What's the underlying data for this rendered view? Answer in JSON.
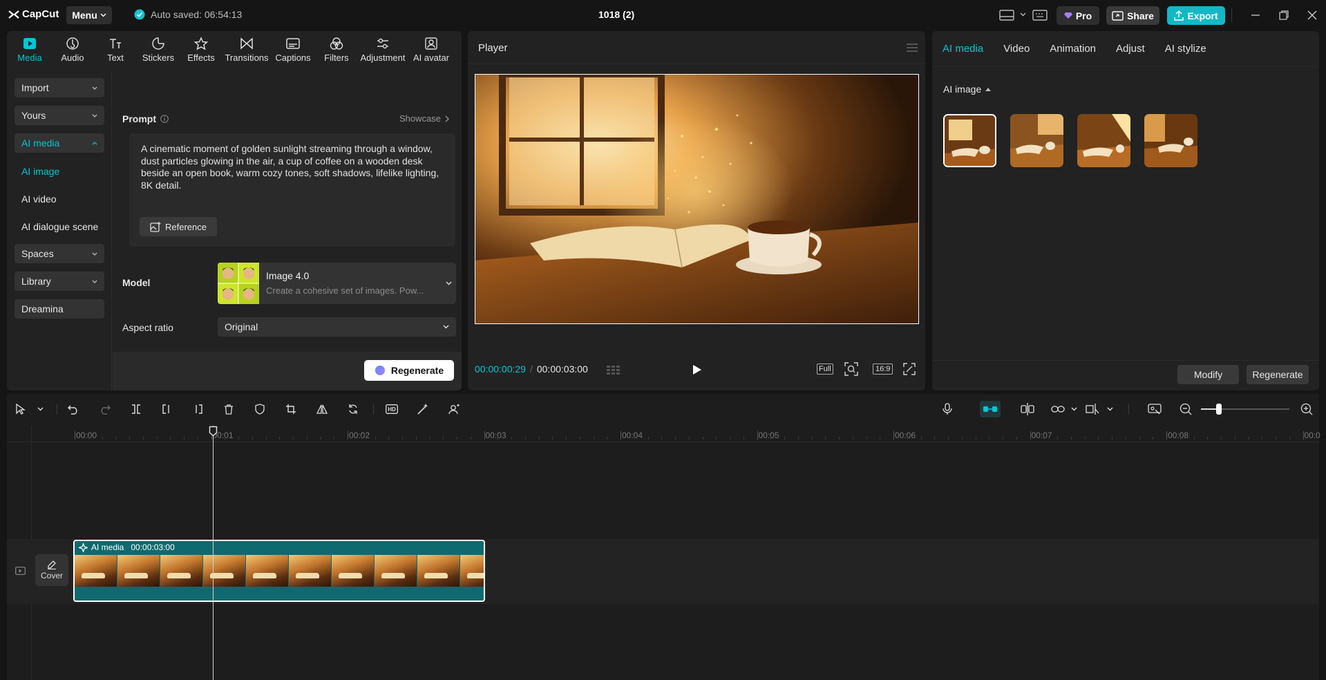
{
  "app": {
    "logo_text": "CapCut",
    "menu_label": "Menu",
    "autosave_text": "Auto saved: 06:54:13",
    "project_title": "1018 (2)",
    "pro_label": "Pro",
    "share_label": "Share",
    "export_label": "Export"
  },
  "toolbar_tabs": [
    {
      "label": "Media",
      "icon": "media-icon"
    },
    {
      "label": "Audio",
      "icon": "audio-icon"
    },
    {
      "label": "Text",
      "icon": "text-icon"
    },
    {
      "label": "Stickers",
      "icon": "stickers-icon"
    },
    {
      "label": "Effects",
      "icon": "effects-icon"
    },
    {
      "label": "Transitions",
      "icon": "transitions-icon"
    },
    {
      "label": "Captions",
      "icon": "captions-icon"
    },
    {
      "label": "Filters",
      "icon": "filters-icon"
    },
    {
      "label": "Adjustment",
      "icon": "adjustment-icon"
    },
    {
      "label": "AI avatar",
      "icon": "ai-avatar-icon"
    }
  ],
  "sidebar": {
    "import": "Import",
    "yours": "Yours",
    "ai_media": "AI media",
    "ai_image": "AI image",
    "ai_video": "AI video",
    "ai_dialogue": "AI dialogue scene",
    "spaces": "Spaces",
    "library": "Library",
    "dreamina": "Dreamina"
  },
  "generator": {
    "prompt_label": "Prompt",
    "showcase_label": "Showcase",
    "prompt_text": "A cinematic moment of golden sunlight streaming through a window, dust particles glowing in the air, a cup of coffee on a wooden desk beside an open book, warm cozy tones, soft shadows, lifelike lighting, 8K detail.",
    "reference_label": "Reference",
    "model_label": "Model",
    "model_name": "Image 4.0",
    "model_desc": "Create a cohesive set of images. Pow...",
    "aspect_label": "Aspect ratio",
    "aspect_value": "Original",
    "regenerate_label": "Regenerate"
  },
  "player": {
    "title": "Player",
    "current_time": "00:00:00:29",
    "separator": "/",
    "total_time": "00:00:03:00",
    "full_label": "Full",
    "ratio_label": "16:9"
  },
  "properties": {
    "tabs": [
      "AI media",
      "Video",
      "Animation",
      "Adjust",
      "AI stylize"
    ],
    "section_title": "AI image",
    "modify_label": "Modify",
    "regenerate_label": "Regenerate"
  },
  "timeline": {
    "ticks": [
      "00:00",
      "00:01",
      "00:02",
      "00:03",
      "00:04",
      "00:05",
      "00:06",
      "00:07",
      "00:08",
      "00:0"
    ],
    "clip_label": "AI media",
    "clip_duration": "00:00:03:00",
    "cover_label": "Cover",
    "zoom_level": 0.2
  },
  "colors": {
    "accent": "#00c8d4",
    "background": "#151515",
    "panel": "#222222",
    "clip": "#0e6a6e"
  }
}
